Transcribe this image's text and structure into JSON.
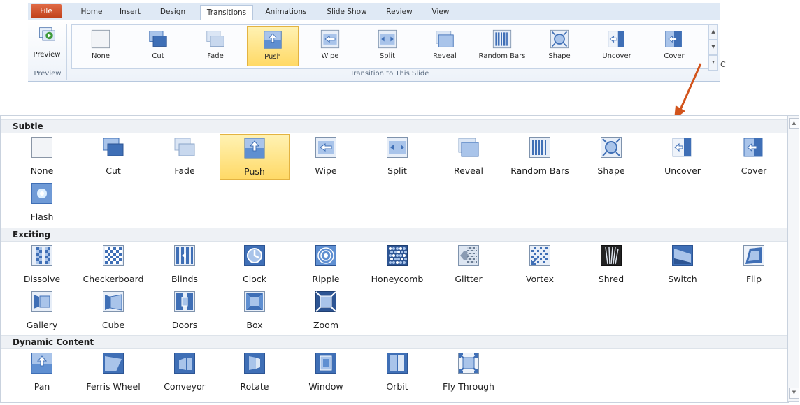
{
  "ribbon": {
    "tabs": [
      "File",
      "Home",
      "Insert",
      "Design",
      "Transitions",
      "Animations",
      "Slide Show",
      "Review",
      "View"
    ],
    "active_tab": "Transitions",
    "preview_label": "Preview",
    "preview_group": "Preview",
    "gallery_group": "Transition to This Slide",
    "side_letter": "C",
    "items": [
      {
        "label": "None",
        "icon": "none-icon"
      },
      {
        "label": "Cut",
        "icon": "cut-icon"
      },
      {
        "label": "Fade",
        "icon": "fade-icon"
      },
      {
        "label": "Push",
        "icon": "push-icon",
        "selected": true
      },
      {
        "label": "Wipe",
        "icon": "wipe-icon"
      },
      {
        "label": "Split",
        "icon": "split-icon"
      },
      {
        "label": "Reveal",
        "icon": "reveal-icon"
      },
      {
        "label": "Random Bars",
        "icon": "random-bars-icon"
      },
      {
        "label": "Shape",
        "icon": "shape-icon"
      },
      {
        "label": "Uncover",
        "icon": "uncover-icon"
      },
      {
        "label": "Cover",
        "icon": "cover-icon"
      }
    ]
  },
  "gallery": {
    "sections": [
      {
        "title": "Subtle",
        "items": [
          {
            "label": "None",
            "icon": "none-icon"
          },
          {
            "label": "Cut",
            "icon": "cut-icon"
          },
          {
            "label": "Fade",
            "icon": "fade-icon"
          },
          {
            "label": "Push",
            "icon": "push-icon",
            "selected": true
          },
          {
            "label": "Wipe",
            "icon": "wipe-icon"
          },
          {
            "label": "Split",
            "icon": "split-icon"
          },
          {
            "label": "Reveal",
            "icon": "reveal-icon"
          },
          {
            "label": "Random Bars",
            "icon": "random-bars-icon"
          },
          {
            "label": "Shape",
            "icon": "shape-icon"
          },
          {
            "label": "Uncover",
            "icon": "uncover-icon"
          },
          {
            "label": "Cover",
            "icon": "cover-icon"
          },
          {
            "label": "Flash",
            "icon": "flash-icon"
          }
        ]
      },
      {
        "title": "Exciting",
        "items": [
          {
            "label": "Dissolve",
            "icon": "dissolve-icon"
          },
          {
            "label": "Checkerboard",
            "icon": "checkerboard-icon"
          },
          {
            "label": "Blinds",
            "icon": "blinds-icon"
          },
          {
            "label": "Clock",
            "icon": "clock-icon"
          },
          {
            "label": "Ripple",
            "icon": "ripple-icon"
          },
          {
            "label": "Honeycomb",
            "icon": "honeycomb-icon"
          },
          {
            "label": "Glitter",
            "icon": "glitter-icon"
          },
          {
            "label": "Vortex",
            "icon": "vortex-icon"
          },
          {
            "label": "Shred",
            "icon": "shred-icon"
          },
          {
            "label": "Switch",
            "icon": "switch-icon"
          },
          {
            "label": "Flip",
            "icon": "flip-icon"
          },
          {
            "label": "Gallery",
            "icon": "gallery-icon"
          },
          {
            "label": "Cube",
            "icon": "cube-icon"
          },
          {
            "label": "Doors",
            "icon": "doors-icon"
          },
          {
            "label": "Box",
            "icon": "box-icon"
          },
          {
            "label": "Zoom",
            "icon": "zoom-icon"
          }
        ]
      },
      {
        "title": "Dynamic Content",
        "items": [
          {
            "label": "Pan",
            "icon": "pan-icon"
          },
          {
            "label": "Ferris Wheel",
            "icon": "ferris-wheel-icon"
          },
          {
            "label": "Conveyor",
            "icon": "conveyor-icon"
          },
          {
            "label": "Rotate",
            "icon": "rotate-icon"
          },
          {
            "label": "Window",
            "icon": "window-icon"
          },
          {
            "label": "Orbit",
            "icon": "orbit-icon"
          },
          {
            "label": "Fly Through",
            "icon": "fly-through-icon"
          }
        ]
      }
    ]
  },
  "colors": {
    "accent_blue": "#3f6fb6",
    "light_blue": "#a9c4ea",
    "selected_fill": "#ffd966",
    "file_tab": "#d0522b",
    "arrow": "#d2541c"
  }
}
